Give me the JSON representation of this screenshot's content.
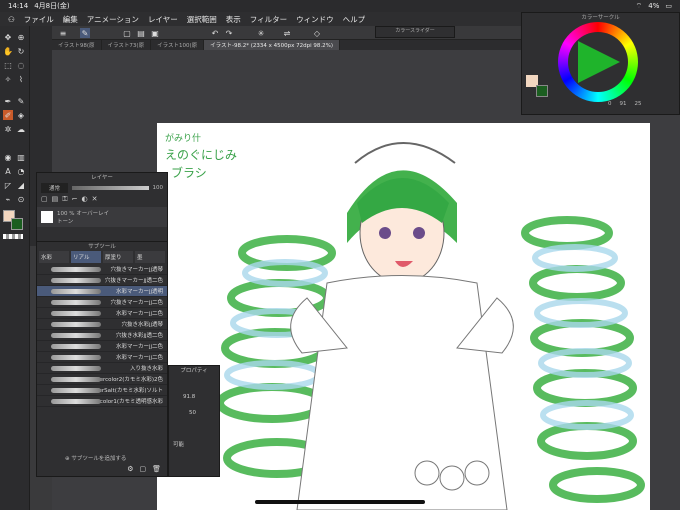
{
  "status": {
    "time": "14:14",
    "date": "4月8日(金)",
    "battery": "4%"
  },
  "menu": [
    "ファイル",
    "編集",
    "アニメーション",
    "レイヤー",
    "選択範囲",
    "表示",
    "フィルター",
    "ウィンドウ",
    "ヘルプ"
  ],
  "tabs": [
    "イラスト98(原",
    "イラスト73(原",
    "イラスト100(原",
    "イラスト-98.2* (2334 x 4500px 72dpi 98.2%)"
  ],
  "color_panel": {
    "title": "カラーサークル",
    "slider_title": "カラースライダー",
    "r": "0",
    "g": "91",
    "b": "25"
  },
  "layer_panel": {
    "title": "レイヤー",
    "blend": "通常",
    "opacity": "100",
    "layer_name": "100 % オーバーレイ",
    "layer_sub": "トーン"
  },
  "subtool": {
    "title": "サブツール",
    "tabs": [
      "水彩",
      "リアル",
      "厚塗り",
      "墨"
    ],
    "brushes": [
      "穴抜きマーカーjj透琴",
      "穴抜きマーカーjj透二色",
      "水彩マーカーjj透明",
      "穴抜きマーカーjj二色",
      "水彩マーカーjj二色",
      "穴抜き水彩jj透琴",
      "穴抜き水彩jj透二色",
      "水彩マーカーjj二色",
      "水彩マーカーjj二色",
      "入り抜き水彩",
      "Watercolor2(カモミ水彩)2色",
      "WaterSalt(カモミ水彩)ソルト",
      "Watercolor1(カモミ透明感水彩"
    ],
    "add_label": "サブツールを追加する"
  },
  "props": {
    "title": "プロパティ",
    "size": "91.8",
    "density": "50",
    "extra": "可能"
  },
  "canvas_text": {
    "note1": "がみり什",
    "note2": "えのぐにじみ",
    "note3": "ブラシ"
  },
  "colors": {
    "accent": "#4a5a7a",
    "main_color": "#f2d7c0",
    "sub_color": "#1b5e20"
  }
}
